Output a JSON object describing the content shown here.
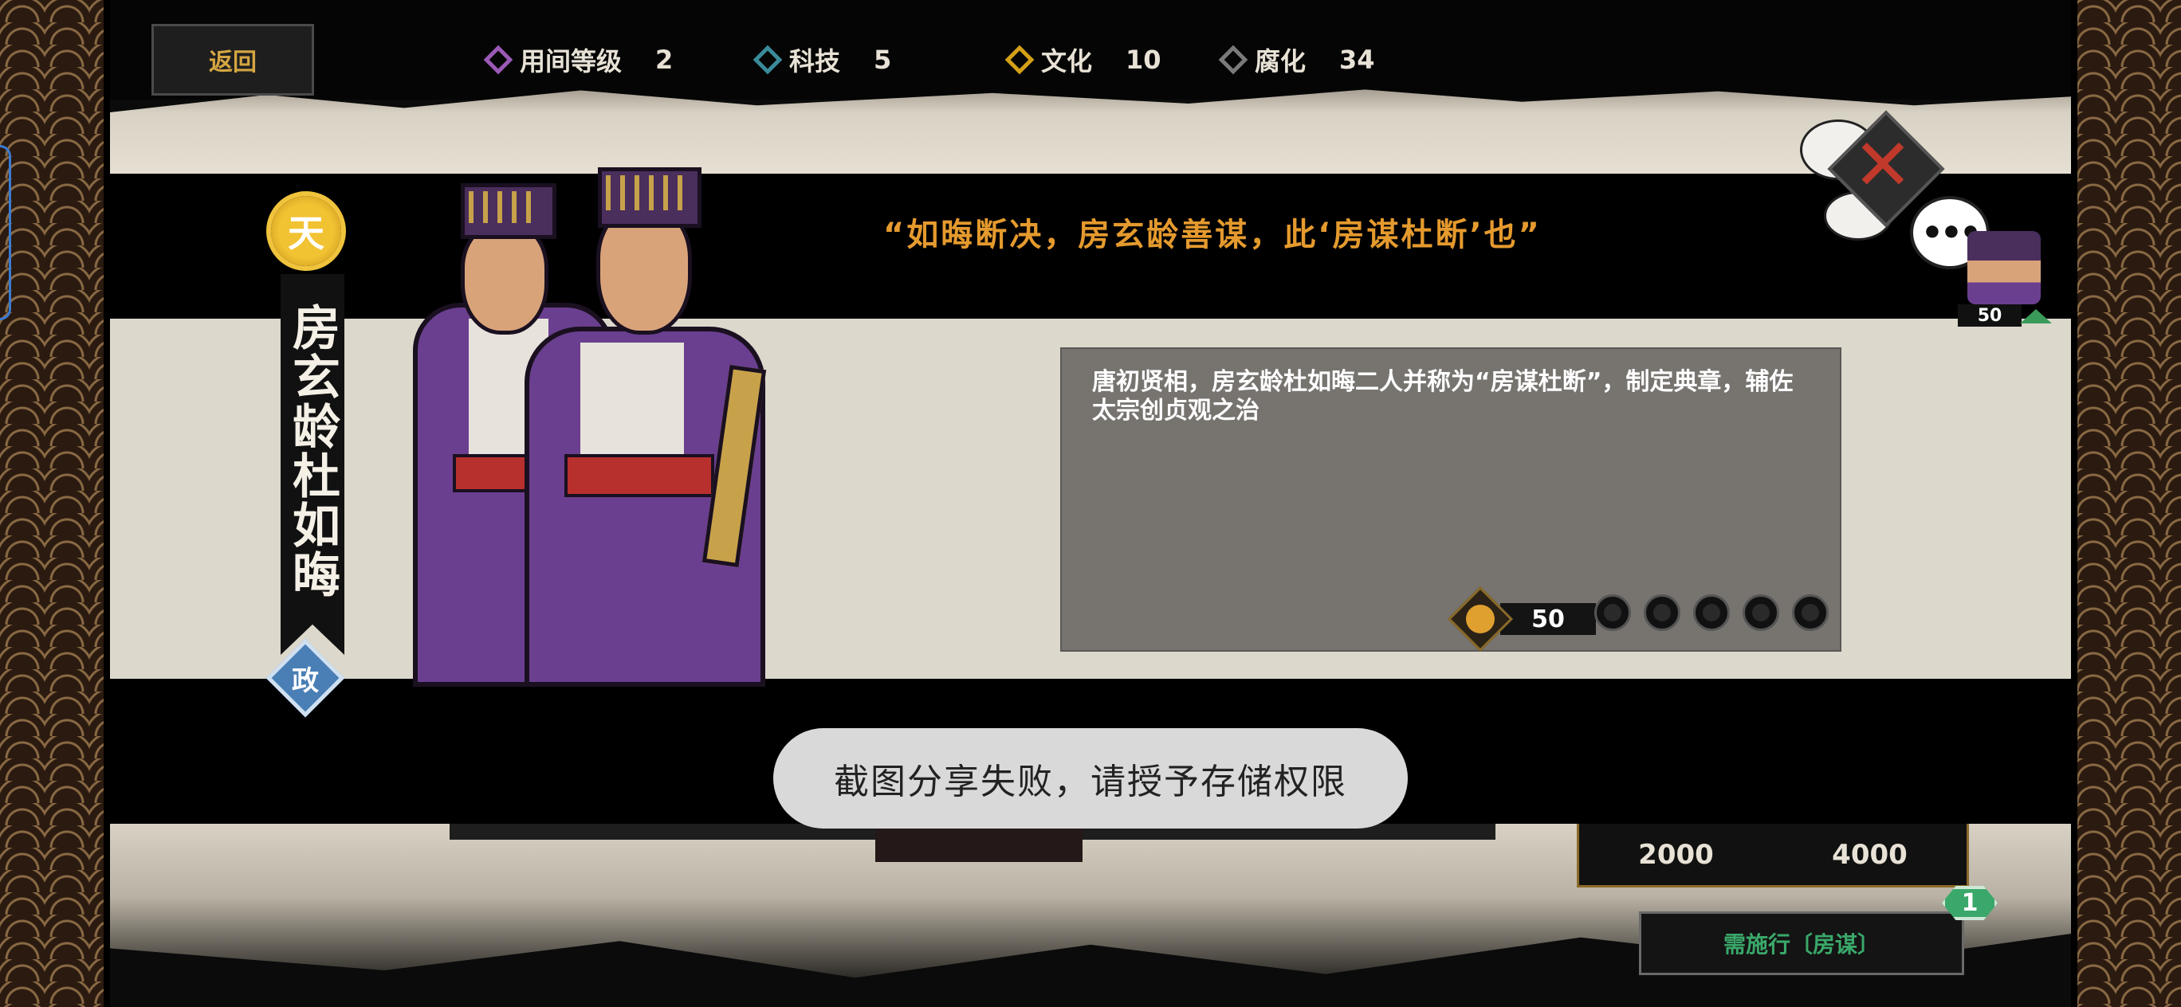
{
  "header": {
    "back_label": "返回",
    "stats": [
      {
        "label": "用间等级",
        "value": "2",
        "color": "#9b59b6"
      },
      {
        "label": "科技",
        "value": "5",
        "color": "#3b8a9a"
      },
      {
        "label": "文化",
        "value": "10",
        "color": "#d4a017"
      },
      {
        "label": "腐化",
        "value": "34",
        "color": "#7a7a7a"
      }
    ]
  },
  "card": {
    "rank": "天",
    "name": "房玄龄杜如晦",
    "category": "政",
    "quote": "“如晦断决，房玄龄善谋，此‘房谋杜断’也”",
    "description": "唐初贤相，房玄龄杜如晦二人并称为“房谋杜断”，制定典章，辅佐太宗创贞观之治",
    "power": "50",
    "stars_total": 5,
    "stars_filled": 0,
    "avatar_level": "50"
  },
  "bottom": {
    "cost_a": "2000",
    "cost_b": "4000",
    "action_label": "需施行〔房谋〕",
    "action_count": "1"
  },
  "toast": {
    "message": "截图分享失败，请授予存储权限"
  },
  "icons": {
    "close": "close-icon",
    "chat": "chat-bubble-icon"
  }
}
